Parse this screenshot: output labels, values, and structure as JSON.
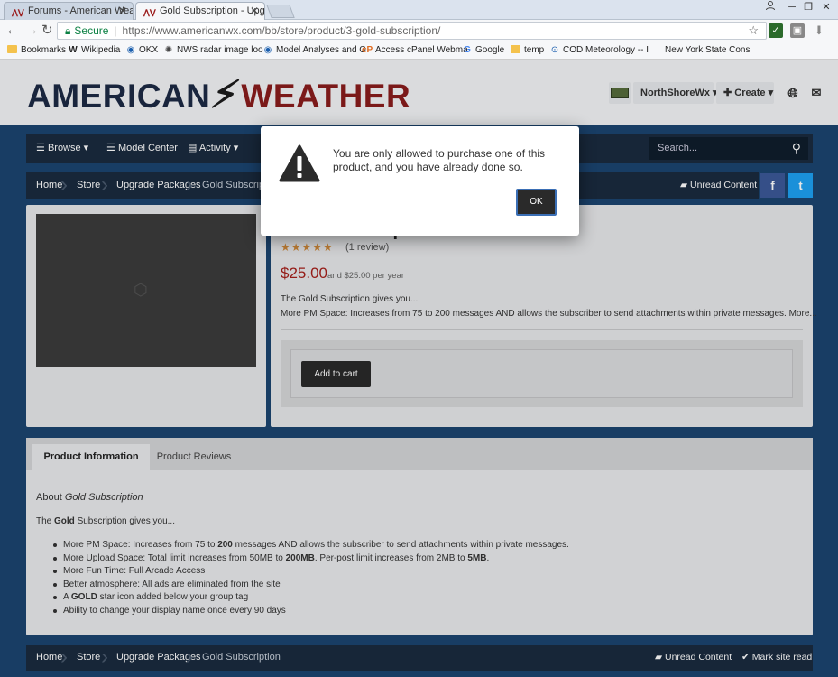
{
  "browser": {
    "tabs": [
      {
        "title": "Forums - American Weat"
      },
      {
        "title": "Gold Subscription - Upgr"
      }
    ],
    "close_glyph": "✕",
    "window_buttons": [
      "─",
      "❐",
      "✕"
    ],
    "secure_label": "Secure",
    "url": "https://www.americanwx.com/bb/store/product/3-gold-subscription/",
    "bookmarks": [
      {
        "label": "Bookmarks",
        "icon": "folder-icon"
      },
      {
        "label": "Wikipedia",
        "icon": "wikipedia-icon"
      },
      {
        "label": "OKX",
        "icon": "noaa-icon"
      },
      {
        "label": "NWS radar image loo",
        "icon": "radar-icon"
      },
      {
        "label": "Model Analyses and G",
        "icon": "noaa-icon"
      },
      {
        "label": "Access cPanel Webma",
        "icon": "cpanel-icon"
      },
      {
        "label": "Google",
        "icon": "google-icon"
      },
      {
        "label": "temp",
        "icon": "folder-icon"
      },
      {
        "label": "COD Meteorology -- I",
        "icon": "cod-icon"
      },
      {
        "label": "New York State Cons",
        "icon": "blank-icon"
      }
    ]
  },
  "site": {
    "logo_left": "AMERICAN",
    "logo_right": "WEATHER",
    "username": "NorthShoreWx",
    "create_label": "Create",
    "nav": [
      {
        "label": "Browse"
      },
      {
        "label": "Model Center"
      },
      {
        "label": "Activity"
      }
    ],
    "search_placeholder": "Search...",
    "breadcrumb": [
      "Home",
      "Store",
      "Upgrade Packages",
      "Gold Subscriptio"
    ],
    "breadcrumb_bottom": [
      "Home",
      "Store",
      "Upgrade Packages",
      "Gold Subscription"
    ],
    "unread_label": "Unread Content",
    "mark_read_label": "Mark site read",
    "facebook_glyph": "f",
    "twitter_glyph": "t"
  },
  "product": {
    "title": "Gold Subscription",
    "rating": 5,
    "stars_text": "★★★★★",
    "reviews": "(1 review)",
    "price": "$25.00",
    "price_sub": "and $25.00 per year",
    "desc_line1": "The Gold Subscription gives you...",
    "desc_line2": "More PM Space: Increases from 75 to 200 messages AND allows the subscriber to send attachments within private messages. More...",
    "add_to_cart": "Add to cart"
  },
  "tabs": {
    "info_label": "Product Information",
    "reviews_label": "Product Reviews"
  },
  "details": {
    "about_prefix": "About",
    "about_name": "Gold Subscription",
    "gives_pre": "The",
    "gives_bold": "Gold",
    "gives_post": "Subscription gives you...",
    "bullets": [
      [
        "More PM Space: Increases from 75 to ",
        "200",
        " messages AND allows the subscriber to send attachments within private messages."
      ],
      [
        "More Upload Space: Total limit increases from 50MB to ",
        "200MB",
        ". Per-post limit increases from 2MB to ",
        "5MB",
        "."
      ],
      [
        "More Fun Time: Full Arcade Access"
      ],
      [
        "Better atmosphere: All ads are eliminated from the site"
      ],
      [
        "A ",
        "GOLD",
        " star icon added below your group tag"
      ],
      [
        "Ability to change your display name once every 90 days"
      ]
    ]
  },
  "dialog": {
    "message": "You are only allowed to purchase one of this product, and you have already done so.",
    "ok_label": "OK"
  }
}
